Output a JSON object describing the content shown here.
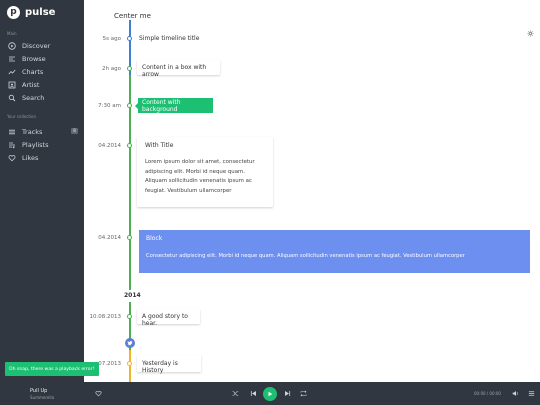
{
  "brand": {
    "name": "pulse",
    "mark": "p"
  },
  "sidebar": {
    "nav_header": "Main",
    "nav_items": [
      {
        "label": "Discover",
        "icon": "play-circle-icon"
      },
      {
        "label": "Browse",
        "icon": "list-icon"
      },
      {
        "label": "Charts",
        "icon": "trending-icon"
      },
      {
        "label": "Artist",
        "icon": "artist-icon"
      },
      {
        "label": "Search",
        "icon": "search-icon"
      }
    ],
    "collection_header": "Your collection",
    "collection_items": [
      {
        "label": "Tracks",
        "icon": "tracks-icon",
        "badge": "8"
      },
      {
        "label": "Playlists",
        "icon": "playlist-icon"
      },
      {
        "label": "Likes",
        "icon": "heart-icon"
      }
    ]
  },
  "timeline": {
    "center_title": "Center me",
    "entries": [
      {
        "time": "5s ago",
        "title": "Simple timeline title"
      },
      {
        "time": "2h ago",
        "title": "Content in a box with arrow"
      },
      {
        "time": "7:30 am",
        "title": "Content with background"
      },
      {
        "time": "04.2014",
        "title": "With Title",
        "body": "Lorem ipsum dolor sit amet, consectetur adipiscing elit. Morbi id neque quam. Aliquam sollicitudin venenatis ipsum ac feugiat. Vestibulum ullamcorper"
      },
      {
        "time": "04.2014",
        "title": "Block",
        "body": "Consectetur adipiscing elit. Morbi id neque quam. Aliquam sollicitudin venenatis ipsum ac feugiat. Vestibulum ullamcorper"
      },
      {
        "time": "10.08.2013",
        "title": "A good story to hear."
      },
      {
        "time": "07.2013",
        "title": "Yesterday is History"
      }
    ],
    "year_marker": "2014"
  },
  "toast": {
    "text": "Oh snap, there was a playback error!"
  },
  "player": {
    "track_title": "Pull Up",
    "track_artist": "Summerella",
    "time": "00:00 / 00:00"
  },
  "colors": {
    "sidebar_bg": "#313740",
    "accent_green": "#1dbf73",
    "block_blue": "#6d8ff0",
    "line_blue": "#3f7fd1",
    "line_green": "#4caf50",
    "line_yellow": "#f0b429"
  }
}
